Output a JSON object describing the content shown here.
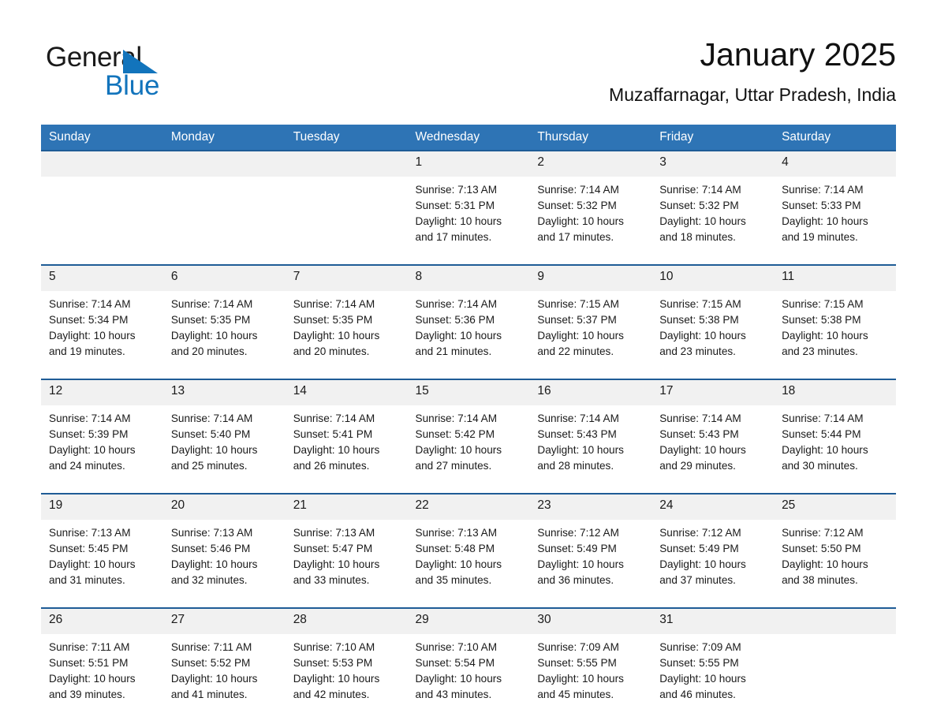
{
  "brand": {
    "name_top": "General",
    "name_bottom": "Blue",
    "triangle_icon": "triangle-icon",
    "color_blue": "#1274bc",
    "color_black": "#1a1a1a"
  },
  "header": {
    "title": "January 2025",
    "subtitle": "Muzaffarnagar, Uttar Pradesh, India"
  },
  "theme": {
    "header_bg": "#2e74b5",
    "header_text": "#ffffff",
    "week_separator": "#1f5c96",
    "daynum_bg": "#f1f1f1",
    "cell_bg": "#ffffff"
  },
  "calendar": {
    "weekday_headers": [
      "Sunday",
      "Monday",
      "Tuesday",
      "Wednesday",
      "Thursday",
      "Friday",
      "Saturday"
    ],
    "weeks": [
      [
        {
          "day": "",
          "lines": []
        },
        {
          "day": "",
          "lines": []
        },
        {
          "day": "",
          "lines": []
        },
        {
          "day": "1",
          "lines": [
            "Sunrise: 7:13 AM",
            "Sunset: 5:31 PM",
            "Daylight: 10 hours",
            "and 17 minutes."
          ]
        },
        {
          "day": "2",
          "lines": [
            "Sunrise: 7:14 AM",
            "Sunset: 5:32 PM",
            "Daylight: 10 hours",
            "and 17 minutes."
          ]
        },
        {
          "day": "3",
          "lines": [
            "Sunrise: 7:14 AM",
            "Sunset: 5:32 PM",
            "Daylight: 10 hours",
            "and 18 minutes."
          ]
        },
        {
          "day": "4",
          "lines": [
            "Sunrise: 7:14 AM",
            "Sunset: 5:33 PM",
            "Daylight: 10 hours",
            "and 19 minutes."
          ]
        }
      ],
      [
        {
          "day": "5",
          "lines": [
            "Sunrise: 7:14 AM",
            "Sunset: 5:34 PM",
            "Daylight: 10 hours",
            "and 19 minutes."
          ]
        },
        {
          "day": "6",
          "lines": [
            "Sunrise: 7:14 AM",
            "Sunset: 5:35 PM",
            "Daylight: 10 hours",
            "and 20 minutes."
          ]
        },
        {
          "day": "7",
          "lines": [
            "Sunrise: 7:14 AM",
            "Sunset: 5:35 PM",
            "Daylight: 10 hours",
            "and 20 minutes."
          ]
        },
        {
          "day": "8",
          "lines": [
            "Sunrise: 7:14 AM",
            "Sunset: 5:36 PM",
            "Daylight: 10 hours",
            "and 21 minutes."
          ]
        },
        {
          "day": "9",
          "lines": [
            "Sunrise: 7:15 AM",
            "Sunset: 5:37 PM",
            "Daylight: 10 hours",
            "and 22 minutes."
          ]
        },
        {
          "day": "10",
          "lines": [
            "Sunrise: 7:15 AM",
            "Sunset: 5:38 PM",
            "Daylight: 10 hours",
            "and 23 minutes."
          ]
        },
        {
          "day": "11",
          "lines": [
            "Sunrise: 7:15 AM",
            "Sunset: 5:38 PM",
            "Daylight: 10 hours",
            "and 23 minutes."
          ]
        }
      ],
      [
        {
          "day": "12",
          "lines": [
            "Sunrise: 7:14 AM",
            "Sunset: 5:39 PM",
            "Daylight: 10 hours",
            "and 24 minutes."
          ]
        },
        {
          "day": "13",
          "lines": [
            "Sunrise: 7:14 AM",
            "Sunset: 5:40 PM",
            "Daylight: 10 hours",
            "and 25 minutes."
          ]
        },
        {
          "day": "14",
          "lines": [
            "Sunrise: 7:14 AM",
            "Sunset: 5:41 PM",
            "Daylight: 10 hours",
            "and 26 minutes."
          ]
        },
        {
          "day": "15",
          "lines": [
            "Sunrise: 7:14 AM",
            "Sunset: 5:42 PM",
            "Daylight: 10 hours",
            "and 27 minutes."
          ]
        },
        {
          "day": "16",
          "lines": [
            "Sunrise: 7:14 AM",
            "Sunset: 5:43 PM",
            "Daylight: 10 hours",
            "and 28 minutes."
          ]
        },
        {
          "day": "17",
          "lines": [
            "Sunrise: 7:14 AM",
            "Sunset: 5:43 PM",
            "Daylight: 10 hours",
            "and 29 minutes."
          ]
        },
        {
          "day": "18",
          "lines": [
            "Sunrise: 7:14 AM",
            "Sunset: 5:44 PM",
            "Daylight: 10 hours",
            "and 30 minutes."
          ]
        }
      ],
      [
        {
          "day": "19",
          "lines": [
            "Sunrise: 7:13 AM",
            "Sunset: 5:45 PM",
            "Daylight: 10 hours",
            "and 31 minutes."
          ]
        },
        {
          "day": "20",
          "lines": [
            "Sunrise: 7:13 AM",
            "Sunset: 5:46 PM",
            "Daylight: 10 hours",
            "and 32 minutes."
          ]
        },
        {
          "day": "21",
          "lines": [
            "Sunrise: 7:13 AM",
            "Sunset: 5:47 PM",
            "Daylight: 10 hours",
            "and 33 minutes."
          ]
        },
        {
          "day": "22",
          "lines": [
            "Sunrise: 7:13 AM",
            "Sunset: 5:48 PM",
            "Daylight: 10 hours",
            "and 35 minutes."
          ]
        },
        {
          "day": "23",
          "lines": [
            "Sunrise: 7:12 AM",
            "Sunset: 5:49 PM",
            "Daylight: 10 hours",
            "and 36 minutes."
          ]
        },
        {
          "day": "24",
          "lines": [
            "Sunrise: 7:12 AM",
            "Sunset: 5:49 PM",
            "Daylight: 10 hours",
            "and 37 minutes."
          ]
        },
        {
          "day": "25",
          "lines": [
            "Sunrise: 7:12 AM",
            "Sunset: 5:50 PM",
            "Daylight: 10 hours",
            "and 38 minutes."
          ]
        }
      ],
      [
        {
          "day": "26",
          "lines": [
            "Sunrise: 7:11 AM",
            "Sunset: 5:51 PM",
            "Daylight: 10 hours",
            "and 39 minutes."
          ]
        },
        {
          "day": "27",
          "lines": [
            "Sunrise: 7:11 AM",
            "Sunset: 5:52 PM",
            "Daylight: 10 hours",
            "and 41 minutes."
          ]
        },
        {
          "day": "28",
          "lines": [
            "Sunrise: 7:10 AM",
            "Sunset: 5:53 PM",
            "Daylight: 10 hours",
            "and 42 minutes."
          ]
        },
        {
          "day": "29",
          "lines": [
            "Sunrise: 7:10 AM",
            "Sunset: 5:54 PM",
            "Daylight: 10 hours",
            "and 43 minutes."
          ]
        },
        {
          "day": "30",
          "lines": [
            "Sunrise: 7:09 AM",
            "Sunset: 5:55 PM",
            "Daylight: 10 hours",
            "and 45 minutes."
          ]
        },
        {
          "day": "31",
          "lines": [
            "Sunrise: 7:09 AM",
            "Sunset: 5:55 PM",
            "Daylight: 10 hours",
            "and 46 minutes."
          ]
        },
        {
          "day": "",
          "lines": []
        }
      ]
    ]
  }
}
